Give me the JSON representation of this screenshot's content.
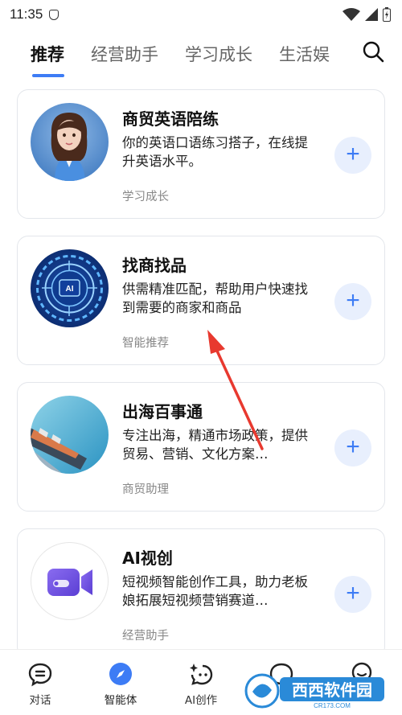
{
  "status_bar": {
    "time": "11:35"
  },
  "tabs": [
    {
      "label": "推荐"
    },
    {
      "label": "经营助手"
    },
    {
      "label": "学习成长"
    },
    {
      "label": "生活娱"
    }
  ],
  "cards": [
    {
      "title": "商贸英语陪练",
      "desc": "你的英语口语练习搭子，在线提升英语水平。",
      "tag": "学习成长"
    },
    {
      "title": "找商找品",
      "desc": "供需精准匹配，帮助用户快速找到需要的商家和商品",
      "tag": "智能推荐"
    },
    {
      "title": "出海百事通",
      "desc": "专注出海，精通市场政策，提供贸易、营销、文化方案…",
      "tag": "商贸助理"
    },
    {
      "title": "AI视创",
      "desc": "短视频智能创作工具，助力老板娘拓展短视频营销赛道…",
      "tag": "经营助手"
    }
  ],
  "bottom_nav": [
    {
      "label": "对话"
    },
    {
      "label": "智能体"
    },
    {
      "label": "AI创作"
    },
    {
      "label": ""
    },
    {
      "label": ""
    }
  ],
  "watermark": {
    "text": "西西软件园",
    "sub": "CR173.COM"
  },
  "colors": {
    "accent": "#3d7cf5",
    "arrow": "#e8392f"
  }
}
